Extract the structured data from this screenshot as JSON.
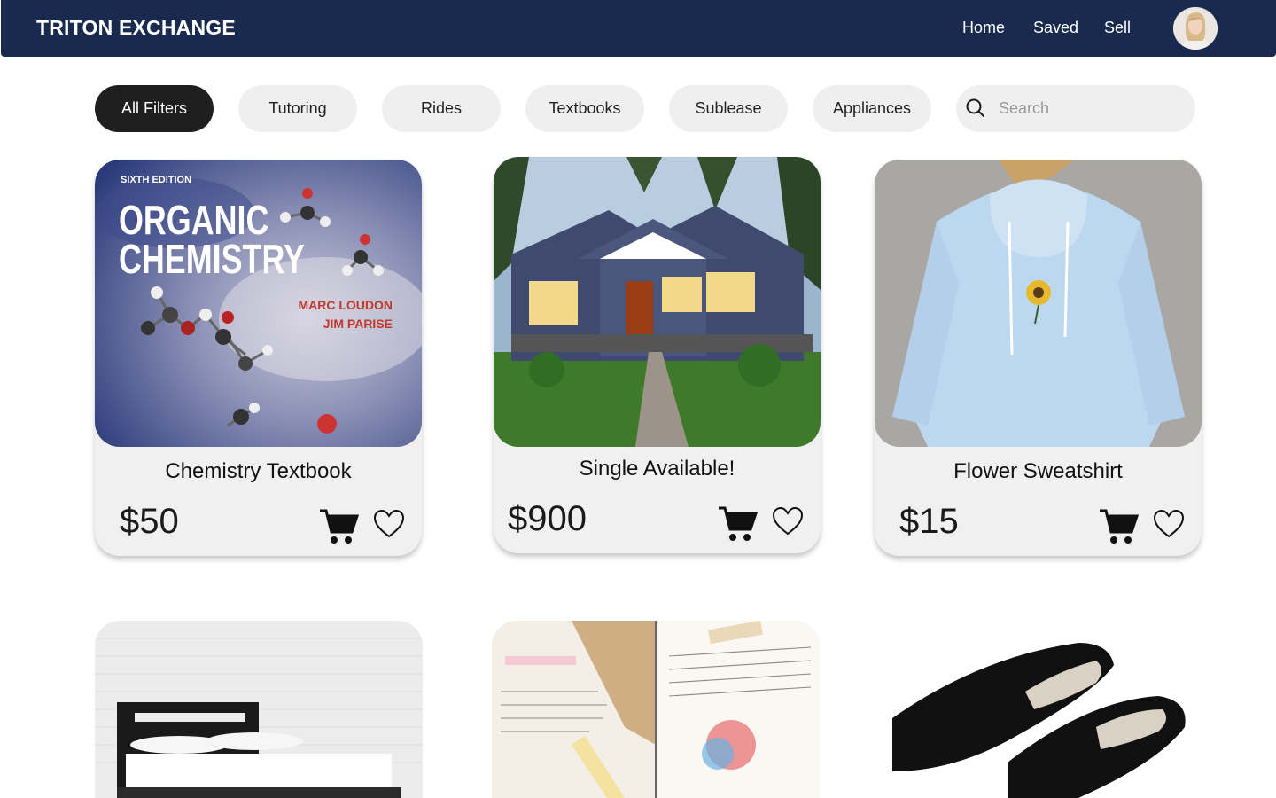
{
  "header": {
    "brand": "TRITON EXCHANGE",
    "nav": [
      "Home",
      "Saved",
      "Sell"
    ]
  },
  "filters": {
    "items": [
      "All Filters",
      "Tutoring",
      "Rides",
      "Textbooks",
      "Sublease",
      "Appliances"
    ],
    "active": "All Filters",
    "search_placeholder": "Search"
  },
  "listings": [
    {
      "title": "Chemistry Textbook",
      "price": "$50",
      "image": "organic-chemistry-book-cover",
      "cover": {
        "edition": "SIXTH EDITION",
        "title_line1": "ORGANIC",
        "title_line2": "CHEMISTRY",
        "author1": "MARC LOUDON",
        "author2": "JIM PARISE"
      }
    },
    {
      "title": "Single Available!",
      "price": "$900",
      "image": "house-photo"
    },
    {
      "title": "Flower Sweatshirt",
      "price": "$15",
      "image": "light-blue-hoodie-photo"
    }
  ],
  "bottom_row": [
    {
      "image": "bed-frame-photo"
    },
    {
      "image": "study-notes-photo"
    },
    {
      "image": "black-slip-on-shoes-photo"
    }
  ],
  "colors": {
    "navbar": "#1a2a4f",
    "pill": "#efefef",
    "pill_active": "#1f1f1f",
    "card": "#f0f0f0"
  }
}
